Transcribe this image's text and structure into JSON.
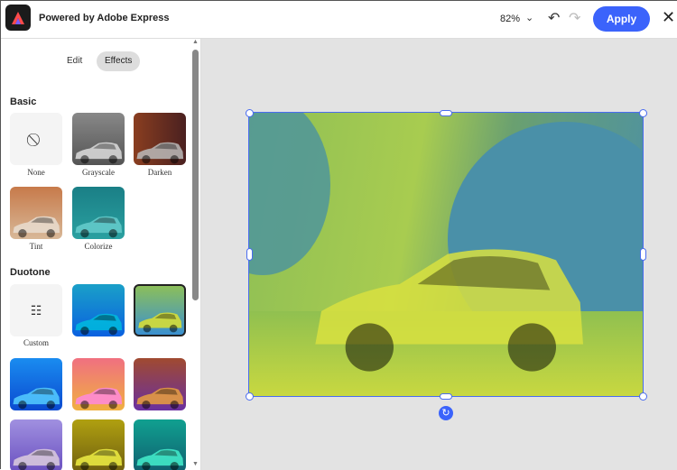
{
  "header": {
    "title": "Powered by Adobe Express",
    "zoom": "82%",
    "apply_label": "Apply"
  },
  "tabs": [
    {
      "label": "Edit"
    },
    {
      "label": "Effects",
      "active": true
    }
  ],
  "basic": {
    "heading": "Basic",
    "items": [
      {
        "label": "None"
      },
      {
        "label": "Grayscale"
      },
      {
        "label": "Darken"
      },
      {
        "label": "Tint"
      },
      {
        "label": "Colorize"
      }
    ]
  },
  "duotone": {
    "heading": "Duotone",
    "custom_label": "Custom"
  },
  "colors": {
    "accent": "#3b63fb",
    "selection": "#4a6cf0"
  }
}
